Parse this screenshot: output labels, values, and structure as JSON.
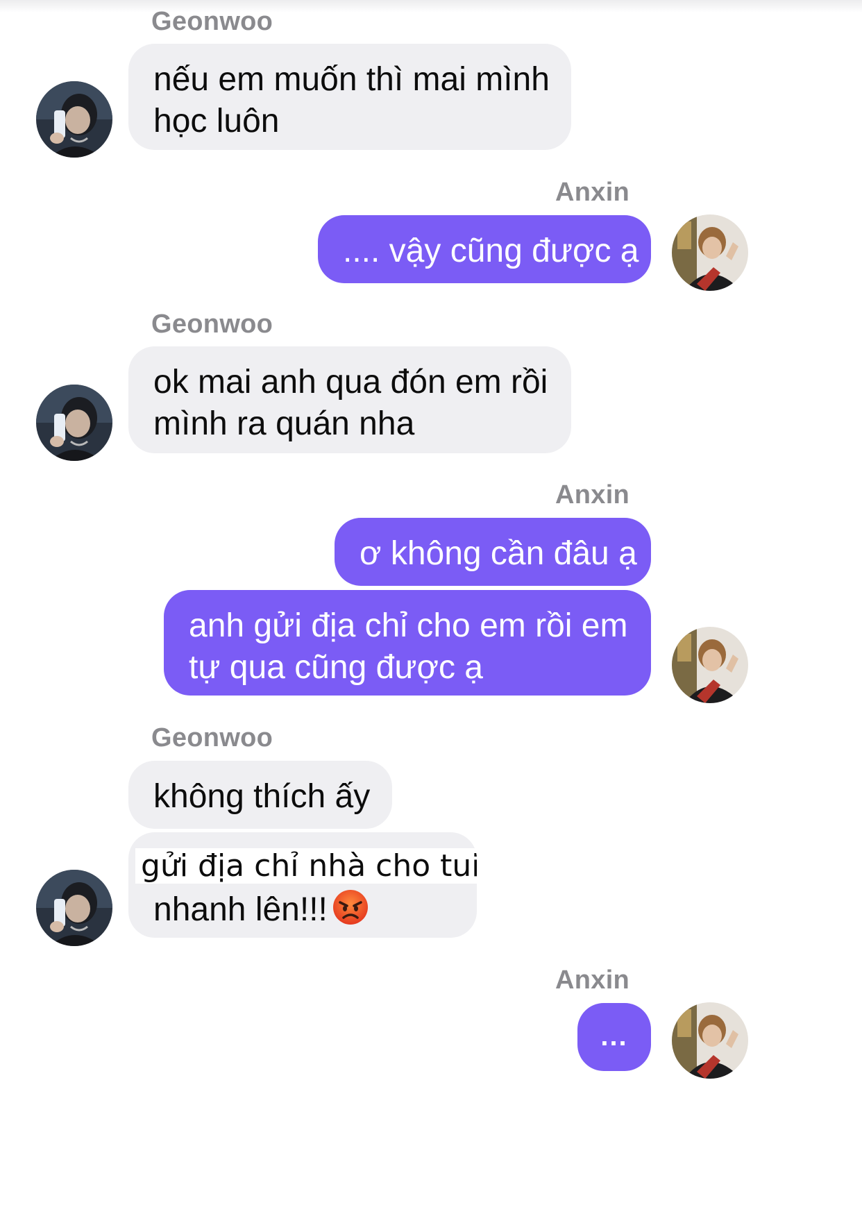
{
  "participants": {
    "other": "Geonwoo",
    "self": "Anxin"
  },
  "messages": [
    {
      "sender": "Geonwoo",
      "bubbles": [
        {
          "lines": [
            "nếu em muốn thì mai mình",
            "học luôn"
          ]
        }
      ]
    },
    {
      "sender": "Anxin",
      "bubbles": [
        {
          "lines": [
            ".... vậy cũng được ạ"
          ]
        }
      ]
    },
    {
      "sender": "Geonwoo",
      "bubbles": [
        {
          "lines": [
            "ok mai anh qua đón em rồi",
            "mình ra quán nha"
          ]
        }
      ]
    },
    {
      "sender": "Anxin",
      "bubbles": [
        {
          "lines": [
            "ơ không cần đâu ạ"
          ]
        },
        {
          "lines": [
            "anh gửi địa chỉ cho em rồi em",
            "tự qua cũng được ạ"
          ]
        }
      ]
    },
    {
      "sender": "Geonwoo",
      "bubbles": [
        {
          "lines": [
            "không thích ấy"
          ]
        },
        {
          "lines": [
            "gửi địa chỉ nhà cho tui",
            "nhanh lên!!!"
          ],
          "emoji": "angry-face"
        }
      ]
    },
    {
      "sender": "Anxin",
      "bubbles": [
        {
          "lines": [
            "..."
          ]
        }
      ]
    }
  ],
  "colors": {
    "outgoing_bubble": "#7b5cf5",
    "incoming_bubble": "#efeff2",
    "sender_name": "#8a8a8e"
  }
}
